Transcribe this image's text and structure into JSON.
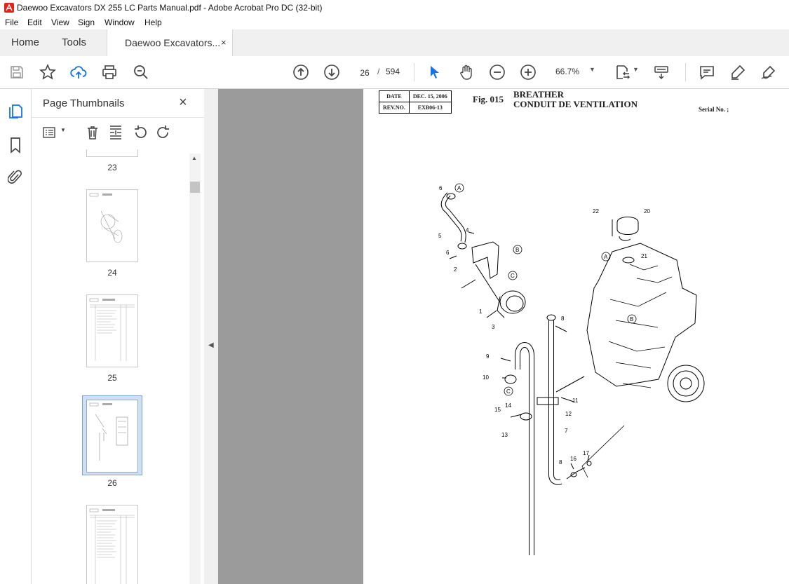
{
  "window": {
    "title": "Daewoo Excavators DX 255 LC Parts Manual.pdf - Adobe Acrobat Pro DC (32-bit)"
  },
  "menu": [
    "File",
    "Edit",
    "View",
    "Sign",
    "Window",
    "Help"
  ],
  "tabs": {
    "home": "Home",
    "tools": "Tools",
    "document": "Daewoo Excavators...",
    "close": "×"
  },
  "toolbar": {
    "page_current": "26",
    "page_sep": "/",
    "page_total": "594",
    "zoom": "66.7%"
  },
  "panel": {
    "title": "Page Thumbnails",
    "close": "×",
    "thumbnails": [
      {
        "label": "23"
      },
      {
        "label": "24"
      },
      {
        "label": "25"
      },
      {
        "label": "26",
        "selected": true
      },
      {
        "label": ""
      }
    ]
  },
  "document": {
    "date_label": "DATE",
    "date_value": "DEC. 15, 2006",
    "rev_label": "REV.NO.",
    "rev_value": "EXB06-13",
    "fig": "Fig. 015",
    "title_en": "BREATHER",
    "title_fr": "CONDUIT DE VENTILATION",
    "serial": "Serial No. ;",
    "callouts": [
      "6",
      "A",
      "5",
      "4",
      "6",
      "B",
      "2",
      "C",
      "1",
      "3",
      "8",
      "9",
      "10",
      "C",
      "15",
      "14",
      "13",
      "12",
      "7",
      "11",
      "8",
      "16",
      "17",
      "22",
      "20",
      "A",
      "21",
      "B"
    ]
  },
  "colors": {
    "accent": "#1473e6",
    "selected_thumb": "#7aa7d8",
    "viewer_bg": "#9b9b9b"
  }
}
